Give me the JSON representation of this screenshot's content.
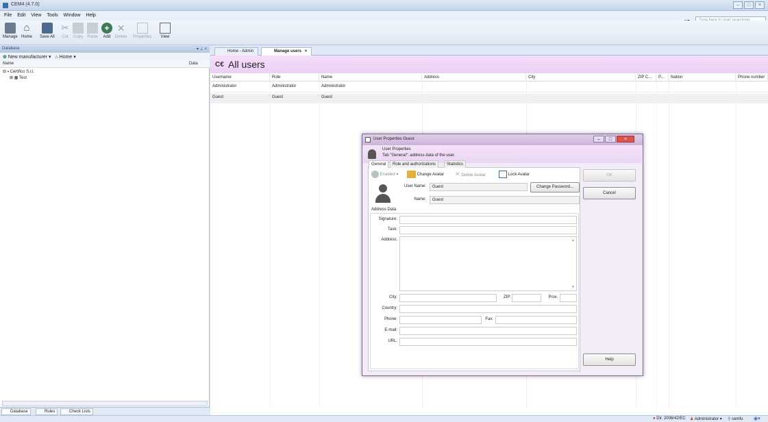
{
  "app": {
    "title": "CEM4 (4.7.0)"
  },
  "menu": [
    "File",
    "Edit",
    "View",
    "Tools",
    "Window",
    "Help"
  ],
  "toolbar": {
    "manage": "Manage",
    "home": "Home",
    "save_all": "Save All",
    "cut": "Cut",
    "copy": "Copy",
    "paste": "Paste",
    "add": "Add",
    "delete": "Delete",
    "properties": "Properties",
    "view": "View"
  },
  "search": {
    "placeholder": "Type here to start searching"
  },
  "left_panel": {
    "title": "Database",
    "new_manufacturer": "New manufacturer",
    "home": "Home",
    "col_name": "Name",
    "col_data": "Data",
    "tree": [
      "Certifico S.r.l.",
      "Test"
    ]
  },
  "bottom_tabs": [
    "Database",
    "Rules",
    "Check Lists"
  ],
  "doc_tabs": [
    "Home - Admin",
    "Manage users"
  ],
  "users": {
    "title": "All users",
    "title_icon": "C€",
    "columns": [
      "Username",
      "Role",
      "Name",
      "Address",
      "City",
      "ZIP C...",
      "P...",
      "Nation",
      "Phone number"
    ],
    "rows": [
      [
        "Administrator",
        "Administrator",
        "Administrator"
      ],
      [
        "Guest",
        "Guest",
        "Guest"
      ]
    ]
  },
  "dialog": {
    "title": "User Properties Guest",
    "head_title": "User Properties",
    "head_sub": "Tab \"General\": address data of the user.",
    "tabs": [
      "General",
      "Role and authorizations",
      "Statistics"
    ],
    "enabled": "Enabled",
    "change_avatar": "Change Avatar",
    "delete_avatar": "Delete Avatar",
    "lock_avatar": "Lock Avatar",
    "user_name_label": "User Name:",
    "user_name_value": "Guest",
    "change_password": "Change Password...",
    "name_label": "Name:",
    "name_value": "Guest",
    "address_data": "Address Data",
    "signature": "Signature:",
    "task": "Task:",
    "address": "Address:",
    "city": "City:",
    "zip": "ZIP:",
    "prov": "Prov.",
    "country": "Country:",
    "phone": "Phone:",
    "fax": "Fax:",
    "email": "E-mail:",
    "url": "URL:",
    "ok": "OK",
    "cancel": "Cancel",
    "help": "Help"
  },
  "status": {
    "directive": "Dir. 2006/42/EC",
    "user": "Administrator",
    "db": "cemfu"
  }
}
